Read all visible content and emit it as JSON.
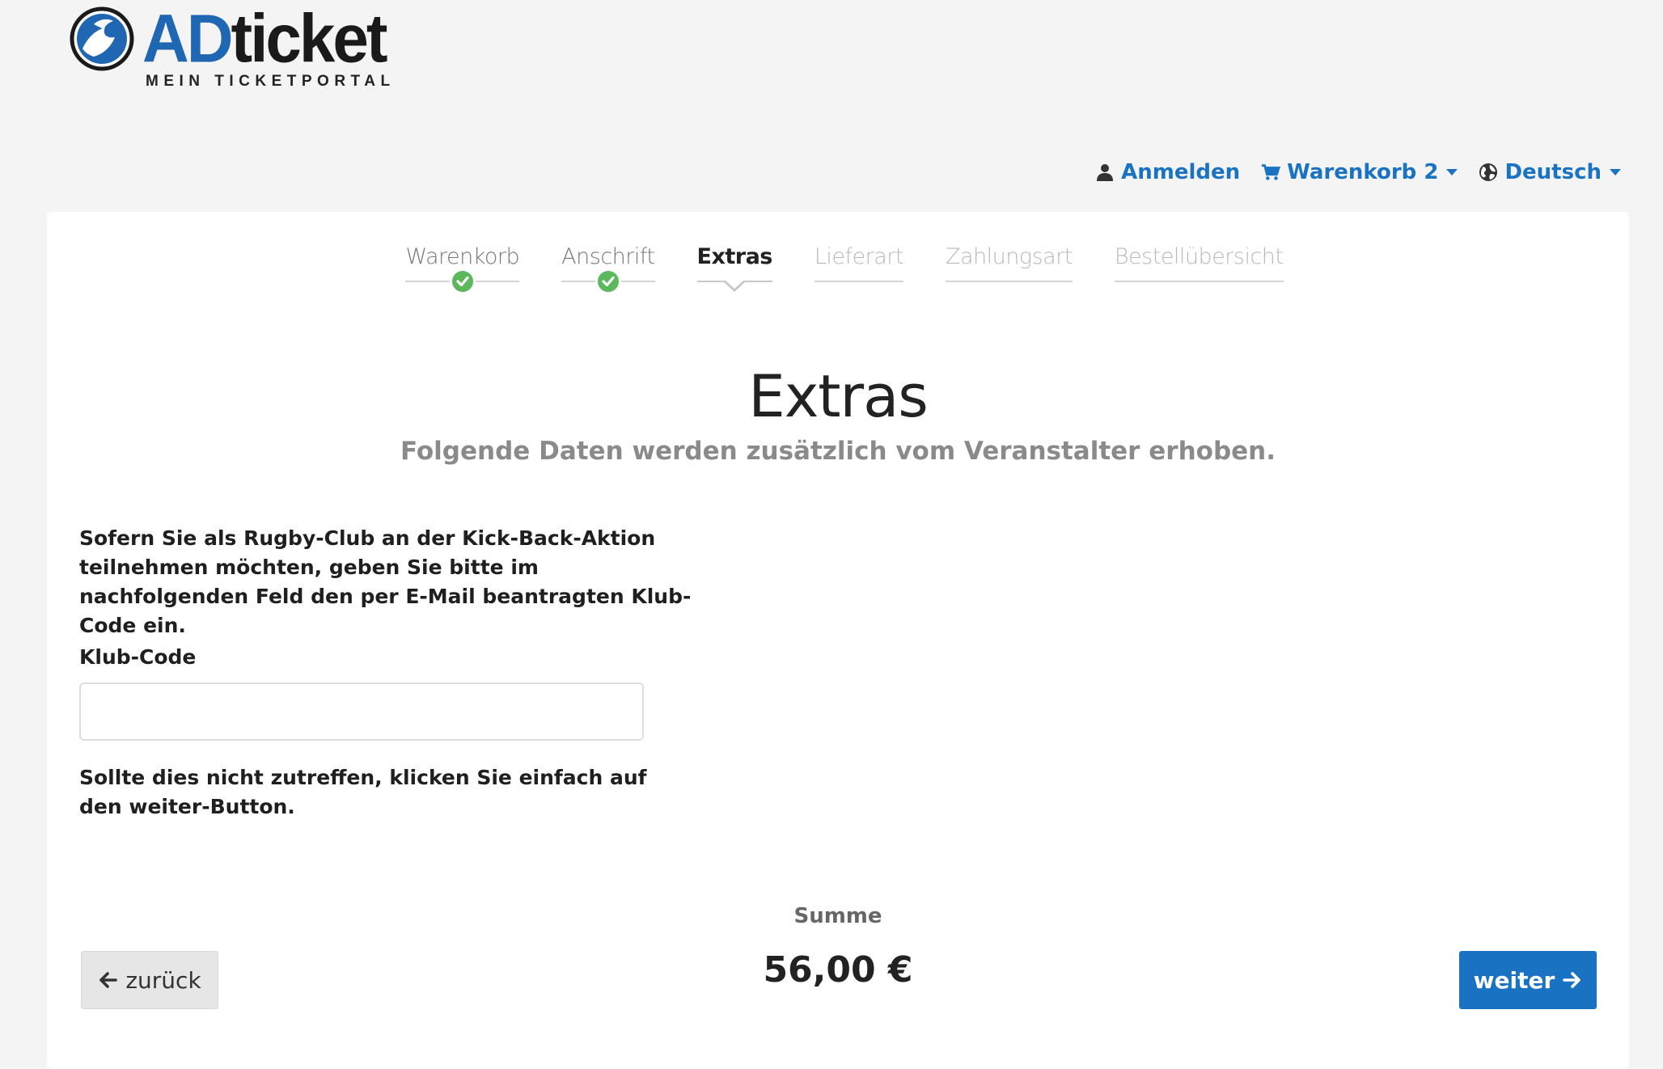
{
  "brand": {
    "name_part1": "AD",
    "name_part2": "ticket",
    "tagline": "MEIN TICKETPORTAL"
  },
  "topnav": {
    "login": "Anmelden",
    "cart": "Warenkorb 2",
    "language": "Deutsch"
  },
  "steps": [
    {
      "label": "Warenkorb",
      "state": "done"
    },
    {
      "label": "Anschrift",
      "state": "done"
    },
    {
      "label": "Extras",
      "state": "active"
    },
    {
      "label": "Lieferart",
      "state": "upcoming"
    },
    {
      "label": "Zahlungsart",
      "state": "upcoming"
    },
    {
      "label": "Bestellübersicht",
      "state": "upcoming"
    }
  ],
  "page": {
    "title": "Extras",
    "subtitle": "Folgende Daten werden zusätzlich vom Veranstalter erhoben."
  },
  "form": {
    "intro": "Sofern Sie als Rugby-Club an der Kick-Back-Aktion teilnehmen möchten, geben Sie bitte im nachfolgenden Feld den per E-Mail beantragten Klub-Code ein.",
    "club_code_label": "Klub-Code",
    "club_code_value": "",
    "note": "Sollte dies nicht zutreffen, klicken Sie einfach auf den weiter-Button."
  },
  "footer": {
    "sum_label": "Summe",
    "sum_value": "56,00 €",
    "back_label": "zurück",
    "next_label": "weiter"
  },
  "colors": {
    "accent": "#1a73c2",
    "success": "#5cb85c",
    "background": "#f4f4f4"
  }
}
